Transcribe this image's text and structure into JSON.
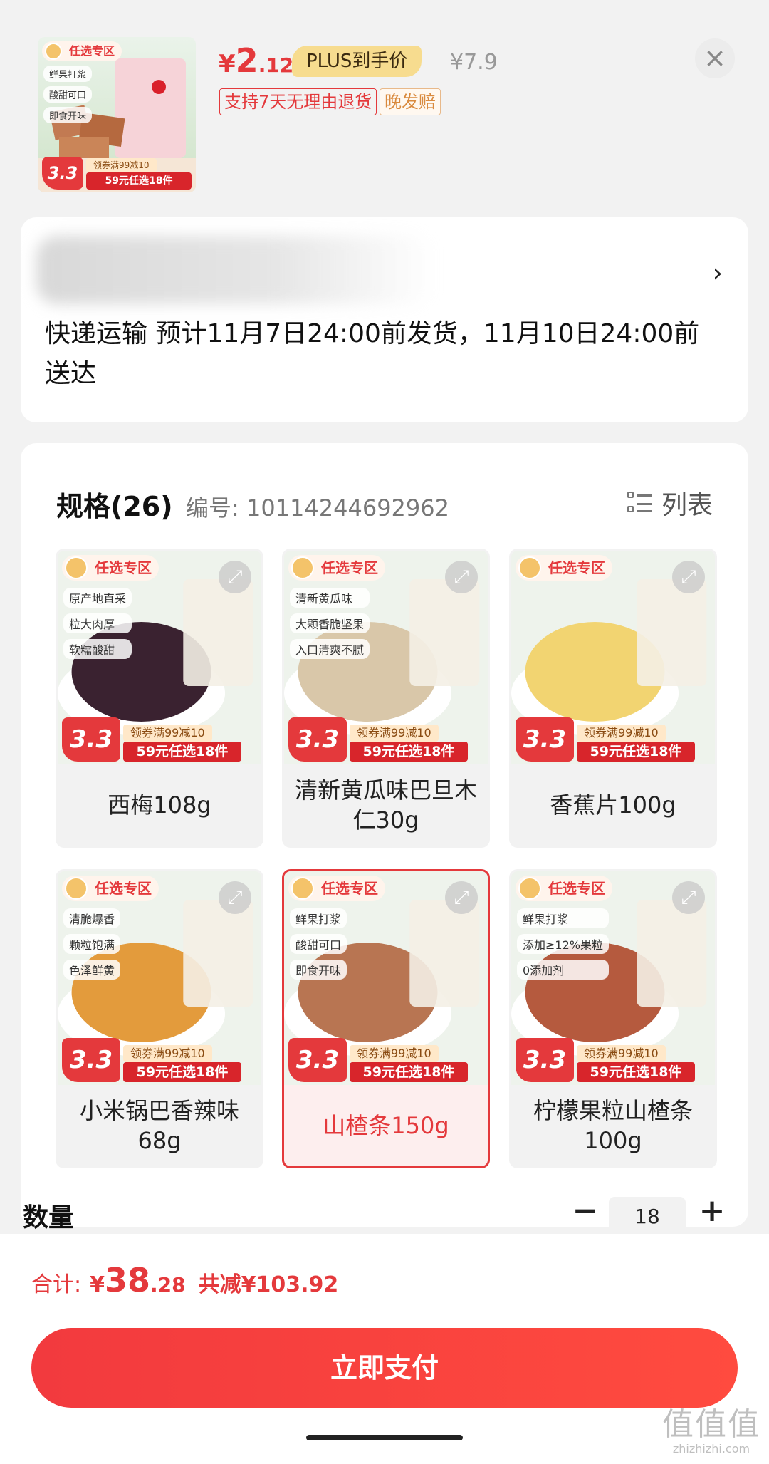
{
  "header": {
    "price_currency": "¥",
    "price_int": "2",
    "price_dec": ".12",
    "plus_badge": "PLUS到手价",
    "original_price": "¥7.9",
    "tag_return": "支持7天无理由退货",
    "tag_late": "晚发赔",
    "close_icon": "close-icon"
  },
  "thumb": {
    "zone": "任选专区",
    "bullets": [
      "鲜果打浆",
      "酸甜可口",
      "即食开味"
    ],
    "ref_price": "3.3",
    "coupon": "领券满99减10",
    "pick": "59元任选18件"
  },
  "address": {
    "arrow": "›",
    "shipping": "快递运输 预计11月7日24:00前发货，11月10日24:00前送达"
  },
  "spec": {
    "title": "规格(26)",
    "code": "编号: 10114244692962",
    "list_label": "列表",
    "options": [
      {
        "label": "西梅108g",
        "bullets": [
          "原产地直采",
          "粒大肉厚",
          "软糯酸甜"
        ],
        "img_color": "#3a2230"
      },
      {
        "label": "清新黄瓜味巴旦木仁30g",
        "bullets": [
          "清新黄瓜味",
          "大颗香脆坚果",
          "入口清爽不腻"
        ],
        "img_color": "#d9c7a9"
      },
      {
        "label": "香蕉片100g",
        "bullets": [],
        "img_color": "#f2d471"
      },
      {
        "label": "小米锅巴香辣味68g",
        "bullets": [
          "清脆爆香",
          "颗粒饱满",
          "色泽鲜黄"
        ],
        "img_color": "#e39b3c"
      },
      {
        "label": "山楂条150g",
        "bullets": [
          "鲜果打浆",
          "酸甜可口",
          "即食开味"
        ],
        "img_color": "#b87552"
      },
      {
        "label": "柠檬果粒山楂条100g",
        "bullets": [
          "鲜果打浆",
          "添加≥12%果粒",
          "0添加剂"
        ],
        "img_color": "#b55a3e"
      }
    ],
    "selected_index": 4,
    "zone": "任选专区",
    "ref_price": "3.3",
    "coupon": "领券满99减10",
    "pick": "59元任选18件"
  },
  "quantity": {
    "label": "数量",
    "minus": "−",
    "value": "18",
    "plus": "+"
  },
  "footer": {
    "total_label": "合计:",
    "total_currency": "¥",
    "total_int": "38",
    "total_dec": ".28",
    "saved": "共减¥103.92",
    "pay_button": "立即支付"
  },
  "watermark": {
    "big": "值值值",
    "small": "zhizhizhi.com"
  },
  "colors": {
    "accent": "#e4393c",
    "plus_gold": "#f7dc8f"
  }
}
